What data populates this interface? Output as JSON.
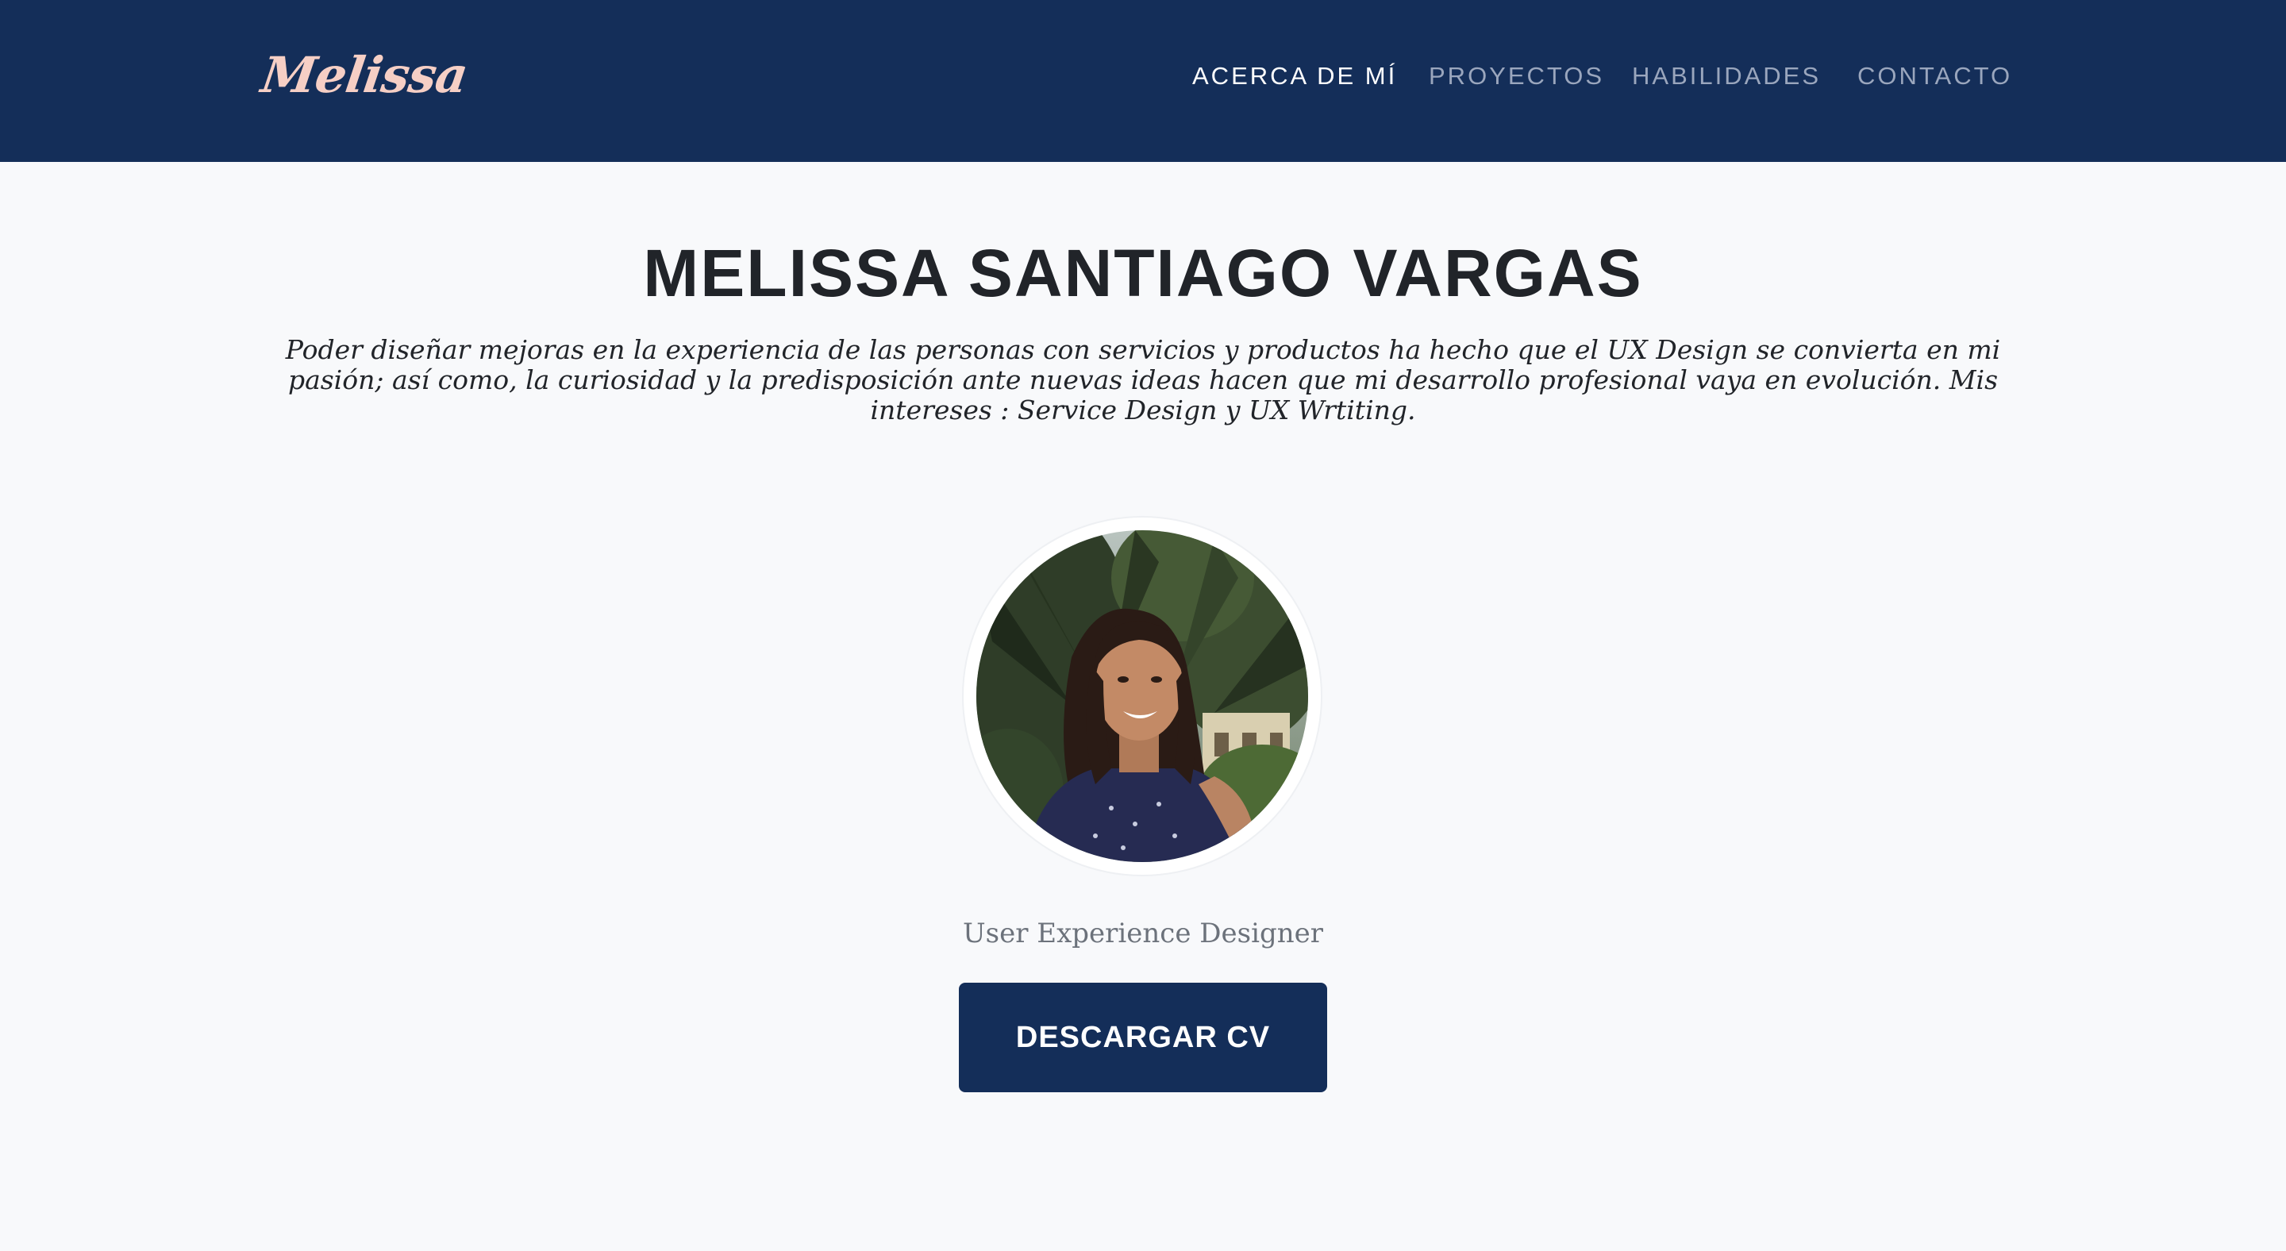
{
  "header": {
    "brand": "Melissa",
    "nav": [
      {
        "label": "ACERCA DE MÍ",
        "active": true
      },
      {
        "label": "PROYECTOS",
        "active": false
      },
      {
        "label": "HABILIDADES",
        "active": false
      },
      {
        "label": "CONTACTO",
        "active": false
      }
    ]
  },
  "hero": {
    "name": "MELISSA SANTIAGO VARGAS",
    "intro": "Poder diseñar mejoras en la experiencia de las personas con servicios y productos ha hecho que el UX Design se convierta en mi pasión; así como, la curiosidad y la predisposición ante nuevas ideas hacen que mi desarrollo profesional vaya en evolución. Mis intereses : Service Design y UX Wrtiting.",
    "role": "User Experience Designer",
    "cv_button": "DESCARGAR CV"
  },
  "colors": {
    "navbar": "#142e59",
    "brand": "#f6cfc5",
    "page_background": "#f8f9fb",
    "button": "#142e59",
    "nav_active": "#ffffff",
    "nav_inactive": "#9aa6bd"
  }
}
